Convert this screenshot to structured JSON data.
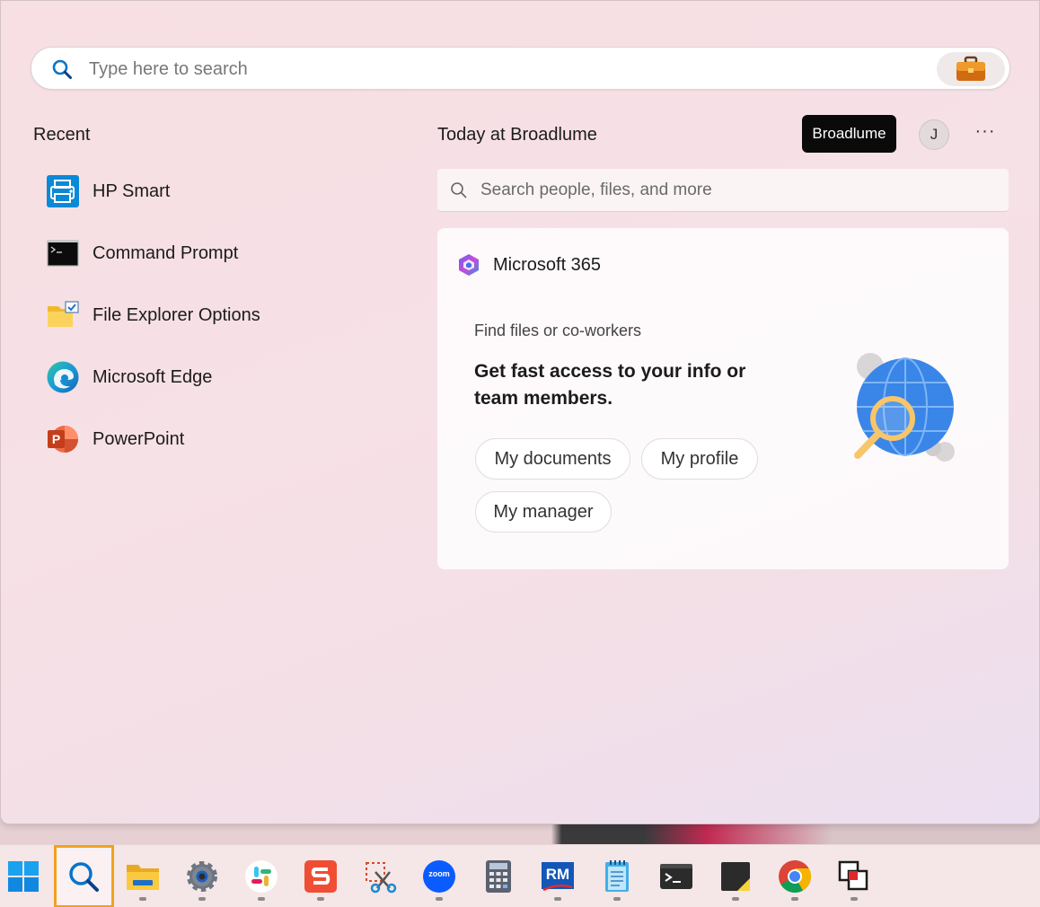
{
  "search": {
    "placeholder": "Type here to search"
  },
  "recent": {
    "title": "Recent",
    "items": [
      {
        "label": "HP Smart",
        "icon": "hp-smart-icon"
      },
      {
        "label": "Command Prompt",
        "icon": "command-prompt-icon"
      },
      {
        "label": "File Explorer Options",
        "icon": "file-explorer-options-icon"
      },
      {
        "label": "Microsoft Edge",
        "icon": "edge-icon"
      },
      {
        "label": "PowerPoint",
        "icon": "powerpoint-icon"
      }
    ]
  },
  "today": {
    "title": "Today at Broadlume",
    "org_badge": "Broadlume",
    "avatar_initial": "J",
    "more": "···",
    "people_search_placeholder": "Search people, files, and more"
  },
  "card": {
    "title": "Microsoft 365",
    "kicker": "Find files or co-workers",
    "headline": "Get fast access to your info or team members.",
    "buttons": [
      "My documents",
      "My profile",
      "My manager"
    ]
  },
  "taskbar": {
    "items": [
      "start-icon",
      "search-icon",
      "file-explorer-icon",
      "settings-icon",
      "slack-icon",
      "snagit-icon",
      "snipping-tool-icon",
      "zoom-icon",
      "calculator-icon",
      "rm-icon",
      "notepad-icon",
      "terminal-icon",
      "sticky-notes-icon",
      "chrome-icon",
      "multi-window-icon"
    ],
    "zoom_label": "zoom",
    "rm_label": "RM"
  },
  "colors": {
    "accent": "#0067c0",
    "highlight": "#f0a21e",
    "badge_bg": "#0a0a0a"
  }
}
